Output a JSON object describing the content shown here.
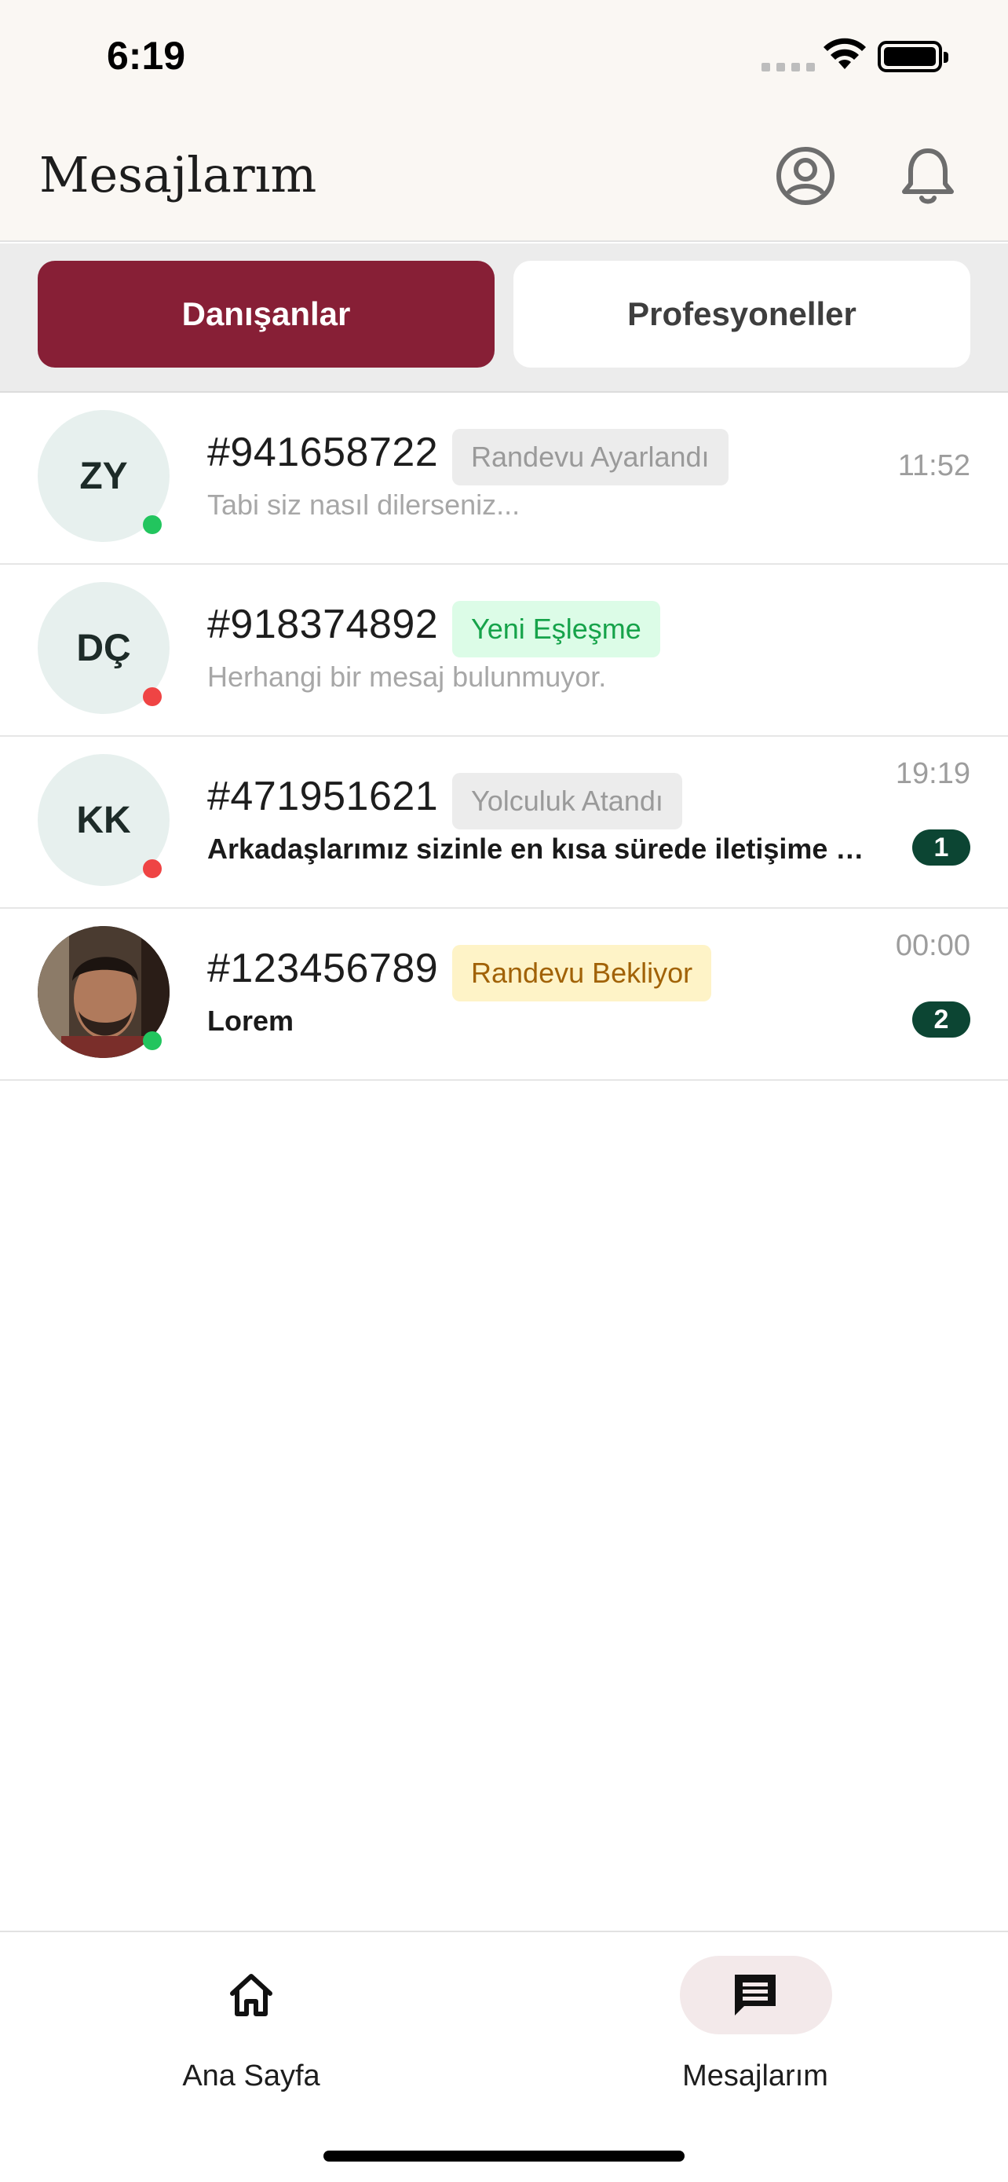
{
  "status_bar": {
    "time": "6:19"
  },
  "header": {
    "title": "Mesajlarım",
    "icons": [
      "profile-icon",
      "bell-icon"
    ]
  },
  "tabs": [
    {
      "label": "Danışanlar",
      "active": true
    },
    {
      "label": "Profesyoneller",
      "active": false
    }
  ],
  "conversations": [
    {
      "initials": "ZY",
      "id": "#941658722",
      "status": "Randevu Ayarlandı",
      "preview": "Tabi siz nasıl dilerseniz...",
      "time": "11:52",
      "unread": "",
      "online": true
    },
    {
      "initials": "DÇ",
      "id": "#918374892",
      "status": "Yeni Eşleşme",
      "preview": "Herhangi bir mesaj bulunmuyor.",
      "time": "",
      "unread": "",
      "online": false
    },
    {
      "initials": "KK",
      "id": "#471951621",
      "status": "Yolculuk Atandı",
      "preview": "Arkadaşlarımız sizinle en kısa sürede iletişime geçecektir.",
      "time": "19:19",
      "unread": "1",
      "online": false
    },
    {
      "initials": "",
      "id": "#123456789",
      "status": "Randevu Bekliyor",
      "preview": "Lorem",
      "time": "00:00",
      "unread": "2",
      "online": true
    }
  ],
  "colors": {
    "brand": "#871f36",
    "online": "#22c55e",
    "offline": "#ef4444",
    "unread_badge": "#0c4533",
    "badge_gray_bg": "#ececec",
    "badge_gray_text": "#9a9a9a",
    "badge_green_bg": "#dcfce7",
    "badge_green_text": "#16a34a",
    "badge_yellow_bg": "#fef3c7",
    "badge_yellow_text": "#a16207"
  },
  "bottom_nav": [
    {
      "label": "Ana Sayfa",
      "icon": "home-icon",
      "active": false
    },
    {
      "label": "Mesajlarım",
      "icon": "chat-icon",
      "active": true
    }
  ]
}
